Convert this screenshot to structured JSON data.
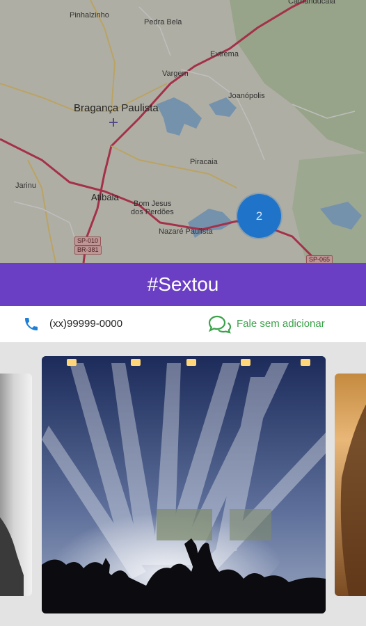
{
  "map": {
    "labels": {
      "pinhalzinho": "Pinhalzinho",
      "pedra_bela": "Pedra Bela",
      "camanducaia": "Camanducaia",
      "extrema": "Extrema",
      "vargem": "Vargem",
      "joanopolis": "Joanópolis",
      "braganca": "Bragança Paulista",
      "piracaia": "Piracaia",
      "jarinu": "Jarinu",
      "atibaia": "Atibaia",
      "bom_jesus_1": "Bom Jesus",
      "bom_jesus_2": "dos Perdões",
      "nazare": "Nazaré Paulista",
      "shield_sp010": "SP-010",
      "shield_br381": "BR-381",
      "shield_sp065": "SP-065"
    },
    "cluster_count": "2",
    "colors": {
      "cluster": "#1f74c9",
      "road": "#c93b5a",
      "water": "#8fb2d3"
    }
  },
  "header": {
    "title": "#Sextou",
    "color": "#6a3fc4"
  },
  "contact": {
    "phone": "(xx)99999-0000",
    "phone_icon": "phone-icon",
    "chat_label": "Fale sem adicionar",
    "chat_icon": "chat-bubbles-icon",
    "chat_color": "#3aa24a"
  },
  "carousel": {
    "cards": [
      "left-photo",
      "concert-photo",
      "right-photo"
    ]
  }
}
